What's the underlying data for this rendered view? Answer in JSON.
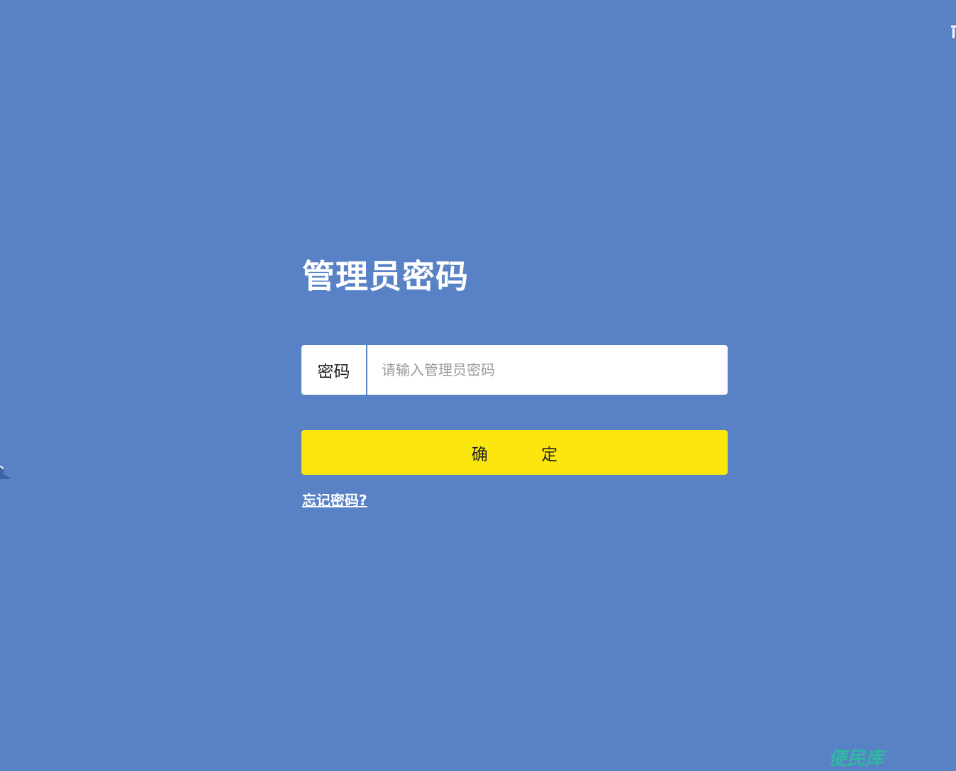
{
  "page": {
    "title": "管理员密码"
  },
  "password_form": {
    "label": "密码",
    "placeholder": "请输入管理员密码",
    "value": "",
    "confirm_label": "确 定",
    "forgot_link": "忘记密码?"
  },
  "watermark": {
    "text": "便民库"
  },
  "colors": {
    "background": "#5882c5",
    "button": "#fbe70f",
    "watermark": "#2fb8a3"
  }
}
